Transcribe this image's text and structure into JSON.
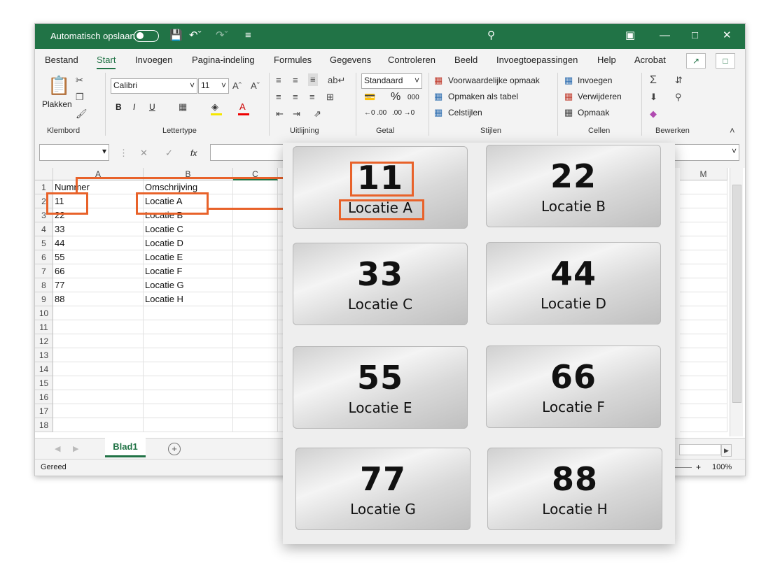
{
  "titlebar": {
    "autosave_label": "Automatisch opslaan",
    "search_icon": "search-icon"
  },
  "menu": {
    "tabs": [
      "Bestand",
      "Start",
      "Invoegen",
      "Pagina-indeling",
      "Formules",
      "Gegevens",
      "Controleren",
      "Beeld",
      "Invoegtoepassingen",
      "Help",
      "Acrobat"
    ],
    "active_tab": "Start"
  },
  "ribbon": {
    "plakken": "Plakken",
    "font_name": "Calibri",
    "font_size": "11",
    "bold": "B",
    "italic": "I",
    "underline": "U",
    "number_format": "Standaard",
    "percent": "%",
    "thousands": "000",
    "inc_dec": "←0 .00",
    "dec_dec": ".00 →0",
    "conditional": "Voorwaardelijke opmaak",
    "format_table": "Opmaken als tabel",
    "cell_styles": "Celstijlen",
    "insert": "Invoegen",
    "delete": "Verwijderen",
    "format": "Opmaak",
    "groups": {
      "clipboard": "Klembord",
      "font": "Lettertype",
      "alignment": "Uitlijning",
      "number": "Getal",
      "styles": "Stijlen",
      "cells": "Cellen",
      "editing": "Bewerken"
    }
  },
  "formula_bar": {
    "fx": "fx",
    "cancel": "✕",
    "confirm": "✓"
  },
  "grid": {
    "columns": [
      "A",
      "B",
      "C",
      "M"
    ],
    "rows": [
      {
        "n": "1",
        "a": "Nummer",
        "b": "Omschrijving"
      },
      {
        "n": "2",
        "a": "11",
        "b": "Locatie A"
      },
      {
        "n": "3",
        "a": "22",
        "b": "Locatie B"
      },
      {
        "n": "4",
        "a": "33",
        "b": "Locatie C"
      },
      {
        "n": "5",
        "a": "44",
        "b": "Locatie D"
      },
      {
        "n": "6",
        "a": "55",
        "b": "Locatie E"
      },
      {
        "n": "7",
        "a": "66",
        "b": "Locatie F"
      },
      {
        "n": "8",
        "a": "77",
        "b": "Locatie G"
      },
      {
        "n": "9",
        "a": "88",
        "b": "Locatie H"
      },
      {
        "n": "10",
        "a": "",
        "b": ""
      },
      {
        "n": "11",
        "a": "",
        "b": ""
      },
      {
        "n": "12",
        "a": "",
        "b": ""
      },
      {
        "n": "13",
        "a": "",
        "b": ""
      },
      {
        "n": "14",
        "a": "",
        "b": ""
      },
      {
        "n": "15",
        "a": "",
        "b": ""
      },
      {
        "n": "16",
        "a": "",
        "b": ""
      },
      {
        "n": "17",
        "a": "",
        "b": ""
      },
      {
        "n": "18",
        "a": "",
        "b": ""
      }
    ]
  },
  "sheet_tabs": {
    "active": "Blad1",
    "add": "+"
  },
  "status": {
    "ready": "Gereed",
    "zoom": "100%",
    "zoom_plus": "+"
  },
  "labels": [
    {
      "num": "11",
      "loc": "Locatie A"
    },
    {
      "num": "22",
      "loc": "Locatie B"
    },
    {
      "num": "33",
      "loc": "Locatie C"
    },
    {
      "num": "44",
      "loc": "Locatie D"
    },
    {
      "num": "55",
      "loc": "Locatie E"
    },
    {
      "num": "66",
      "loc": "Locatie F"
    },
    {
      "num": "77",
      "loc": "Locatie G"
    },
    {
      "num": "88",
      "loc": "Locatie H"
    }
  ],
  "colors": {
    "excel_green": "#217346",
    "highlight": "#e8622a"
  }
}
